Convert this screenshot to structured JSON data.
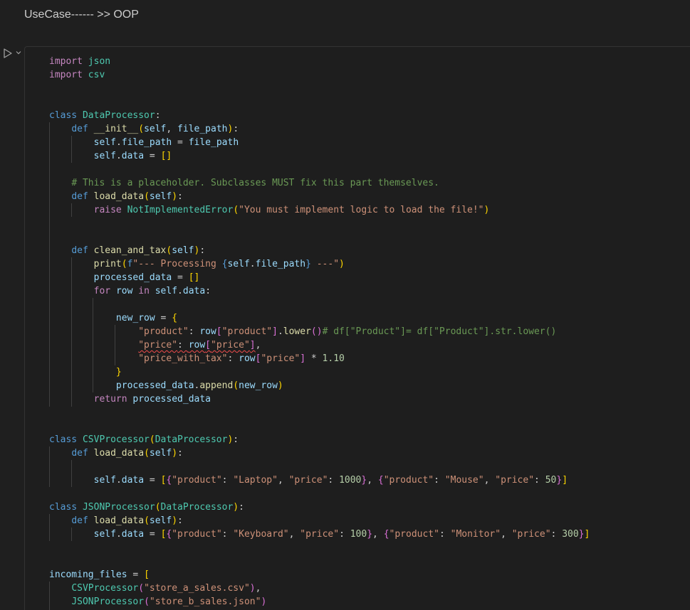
{
  "markdown_heading": "UseCase------ >> OOP",
  "code_lines": [
    [
      [
        "kw",
        "import"
      ],
      [
        "txt",
        " "
      ],
      [
        "cls",
        "json"
      ]
    ],
    [
      [
        "kw",
        "import"
      ],
      [
        "txt",
        " "
      ],
      [
        "cls",
        "csv"
      ]
    ],
    [],
    [],
    [
      [
        "kb",
        "class"
      ],
      [
        "txt",
        " "
      ],
      [
        "cls",
        "DataProcessor"
      ],
      [
        "txt",
        ":"
      ]
    ],
    [
      [
        "txt",
        "    "
      ],
      [
        "kb",
        "def"
      ],
      [
        "txt",
        " "
      ],
      [
        "fn",
        "__init__"
      ],
      [
        "br1",
        "("
      ],
      [
        "var",
        "self"
      ],
      [
        "txt",
        ", "
      ],
      [
        "var",
        "file_path"
      ],
      [
        "br1",
        ")"
      ],
      [
        "txt",
        ":"
      ]
    ],
    [
      [
        "txt",
        "        "
      ],
      [
        "var",
        "self"
      ],
      [
        "txt",
        "."
      ],
      [
        "var",
        "file_path"
      ],
      [
        "txt",
        " = "
      ],
      [
        "var",
        "file_path"
      ]
    ],
    [
      [
        "txt",
        "        "
      ],
      [
        "var",
        "self"
      ],
      [
        "txt",
        "."
      ],
      [
        "var",
        "data"
      ],
      [
        "txt",
        " = "
      ],
      [
        "br1",
        "[]"
      ]
    ],
    [],
    [
      [
        "txt",
        "    "
      ],
      [
        "cmt",
        "# This is a placeholder. Subclasses MUST fix this part themselves."
      ]
    ],
    [
      [
        "txt",
        "    "
      ],
      [
        "kb",
        "def"
      ],
      [
        "txt",
        " "
      ],
      [
        "fn",
        "load_data"
      ],
      [
        "br1",
        "("
      ],
      [
        "var",
        "self"
      ],
      [
        "br1",
        ")"
      ],
      [
        "txt",
        ":"
      ]
    ],
    [
      [
        "txt",
        "        "
      ],
      [
        "kw",
        "raise"
      ],
      [
        "txt",
        " "
      ],
      [
        "cls",
        "NotImplementedError"
      ],
      [
        "br1",
        "("
      ],
      [
        "str",
        "\"You must implement logic to load the file!\""
      ],
      [
        "br1",
        ")"
      ]
    ],
    [],
    [],
    [
      [
        "txt",
        "    "
      ],
      [
        "kb",
        "def"
      ],
      [
        "txt",
        " "
      ],
      [
        "fn",
        "clean_and_tax"
      ],
      [
        "br1",
        "("
      ],
      [
        "var",
        "self"
      ],
      [
        "br1",
        ")"
      ],
      [
        "txt",
        ":"
      ]
    ],
    [
      [
        "txt",
        "        "
      ],
      [
        "fn",
        "print"
      ],
      [
        "br1",
        "("
      ],
      [
        "kb",
        "f"
      ],
      [
        "str",
        "\"--- Processing "
      ],
      [
        "kb",
        "{"
      ],
      [
        "var",
        "self"
      ],
      [
        "txt",
        "."
      ],
      [
        "var",
        "file_path"
      ],
      [
        "kb",
        "}"
      ],
      [
        "str",
        " ---\""
      ],
      [
        "br1",
        ")"
      ]
    ],
    [
      [
        "txt",
        "        "
      ],
      [
        "var",
        "processed_data"
      ],
      [
        "txt",
        " = "
      ],
      [
        "br1",
        "[]"
      ]
    ],
    [
      [
        "txt",
        "        "
      ],
      [
        "kw",
        "for"
      ],
      [
        "txt",
        " "
      ],
      [
        "var",
        "row"
      ],
      [
        "txt",
        " "
      ],
      [
        "kw",
        "in"
      ],
      [
        "txt",
        " "
      ],
      [
        "var",
        "self"
      ],
      [
        "txt",
        "."
      ],
      [
        "var",
        "data"
      ],
      [
        "txt",
        ":"
      ]
    ],
    [],
    [
      [
        "txt",
        "            "
      ],
      [
        "var",
        "new_row"
      ],
      [
        "txt",
        " = "
      ],
      [
        "br1",
        "{"
      ]
    ],
    [
      [
        "txt",
        "                "
      ],
      [
        "str",
        "\"product\""
      ],
      [
        "txt",
        ": "
      ],
      [
        "var",
        "row"
      ],
      [
        "br2",
        "["
      ],
      [
        "str",
        "\"product\""
      ],
      [
        "br2",
        "]"
      ],
      [
        "txt",
        "."
      ],
      [
        "fn",
        "lower"
      ],
      [
        "br2",
        "()"
      ],
      [
        "cmt",
        "# df[\"Product\"]= df[\"Product\"].str.lower()"
      ]
    ],
    [
      [
        "txt",
        "                "
      ],
      [
        "str",
        "\"price\"",
        "sq"
      ],
      [
        "txt",
        ": ",
        "sq"
      ],
      [
        "var",
        "row",
        "sq"
      ],
      [
        "br2",
        "[",
        "sq"
      ],
      [
        "str",
        "\"price\"",
        "sq"
      ],
      [
        "br2",
        "]",
        "sq"
      ],
      [
        "txt",
        ","
      ]
    ],
    [
      [
        "txt",
        "                "
      ],
      [
        "str",
        "\"price_with_tax\""
      ],
      [
        "txt",
        ": "
      ],
      [
        "var",
        "row"
      ],
      [
        "br2",
        "["
      ],
      [
        "str",
        "\"price\""
      ],
      [
        "br2",
        "]"
      ],
      [
        "txt",
        " * "
      ],
      [
        "num",
        "1.10"
      ]
    ],
    [
      [
        "txt",
        "            "
      ],
      [
        "br1",
        "}"
      ]
    ],
    [
      [
        "txt",
        "            "
      ],
      [
        "var",
        "processed_data"
      ],
      [
        "txt",
        "."
      ],
      [
        "fn",
        "append"
      ],
      [
        "br1",
        "("
      ],
      [
        "var",
        "new_row"
      ],
      [
        "br1",
        ")"
      ]
    ],
    [
      [
        "txt",
        "        "
      ],
      [
        "kw",
        "return"
      ],
      [
        "txt",
        " "
      ],
      [
        "var",
        "processed_data"
      ]
    ],
    [],
    [],
    [
      [
        "kb",
        "class"
      ],
      [
        "txt",
        " "
      ],
      [
        "cls",
        "CSVProcessor"
      ],
      [
        "br1",
        "("
      ],
      [
        "cls",
        "DataProcessor"
      ],
      [
        "br1",
        ")"
      ],
      [
        "txt",
        ":"
      ]
    ],
    [
      [
        "txt",
        "    "
      ],
      [
        "kb",
        "def"
      ],
      [
        "txt",
        " "
      ],
      [
        "fn",
        "load_data"
      ],
      [
        "br1",
        "("
      ],
      [
        "var",
        "self"
      ],
      [
        "br1",
        ")"
      ],
      [
        "txt",
        ":"
      ]
    ],
    [],
    [
      [
        "txt",
        "        "
      ],
      [
        "var",
        "self"
      ],
      [
        "txt",
        "."
      ],
      [
        "var",
        "data"
      ],
      [
        "txt",
        " = "
      ],
      [
        "br1",
        "["
      ],
      [
        "br2",
        "{"
      ],
      [
        "str",
        "\"product\""
      ],
      [
        "txt",
        ": "
      ],
      [
        "str",
        "\"Laptop\""
      ],
      [
        "txt",
        ", "
      ],
      [
        "str",
        "\"price\""
      ],
      [
        "txt",
        ": "
      ],
      [
        "num",
        "1000"
      ],
      [
        "br2",
        "}"
      ],
      [
        "txt",
        ", "
      ],
      [
        "br2",
        "{"
      ],
      [
        "str",
        "\"product\""
      ],
      [
        "txt",
        ": "
      ],
      [
        "str",
        "\"Mouse\""
      ],
      [
        "txt",
        ", "
      ],
      [
        "str",
        "\"price\""
      ],
      [
        "txt",
        ": "
      ],
      [
        "num",
        "50"
      ],
      [
        "br2",
        "}"
      ],
      [
        "br1",
        "]"
      ]
    ],
    [],
    [
      [
        "kb",
        "class"
      ],
      [
        "txt",
        " "
      ],
      [
        "cls",
        "JSONProcessor"
      ],
      [
        "br1",
        "("
      ],
      [
        "cls",
        "DataProcessor"
      ],
      [
        "br1",
        ")"
      ],
      [
        "txt",
        ":"
      ]
    ],
    [
      [
        "txt",
        "    "
      ],
      [
        "kb",
        "def"
      ],
      [
        "txt",
        " "
      ],
      [
        "fn",
        "load_data"
      ],
      [
        "br1",
        "("
      ],
      [
        "var",
        "self"
      ],
      [
        "br1",
        ")"
      ],
      [
        "txt",
        ":"
      ]
    ],
    [
      [
        "txt",
        "        "
      ],
      [
        "var",
        "self"
      ],
      [
        "txt",
        "."
      ],
      [
        "var",
        "data"
      ],
      [
        "txt",
        " = "
      ],
      [
        "br1",
        "["
      ],
      [
        "br2",
        "{"
      ],
      [
        "str",
        "\"product\""
      ],
      [
        "txt",
        ": "
      ],
      [
        "str",
        "\"Keyboard\""
      ],
      [
        "txt",
        ", "
      ],
      [
        "str",
        "\"price\""
      ],
      [
        "txt",
        ": "
      ],
      [
        "num",
        "100"
      ],
      [
        "br2",
        "}"
      ],
      [
        "txt",
        ", "
      ],
      [
        "br2",
        "{"
      ],
      [
        "str",
        "\"product\""
      ],
      [
        "txt",
        ": "
      ],
      [
        "str",
        "\"Monitor\""
      ],
      [
        "txt",
        ", "
      ],
      [
        "str",
        "\"price\""
      ],
      [
        "txt",
        ": "
      ],
      [
        "num",
        "300"
      ],
      [
        "br2",
        "}"
      ],
      [
        "br1",
        "]"
      ]
    ],
    [],
    [],
    [
      [
        "var",
        "incoming_files"
      ],
      [
        "txt",
        " = "
      ],
      [
        "br1",
        "["
      ]
    ],
    [
      [
        "txt",
        "    "
      ],
      [
        "cls",
        "CSVProcessor"
      ],
      [
        "br2",
        "("
      ],
      [
        "str",
        "\"store_a_sales.csv\""
      ],
      [
        "br2",
        ")"
      ],
      [
        "txt",
        ","
      ]
    ],
    [
      [
        "txt",
        "    "
      ],
      [
        "cls",
        "JSONProcessor"
      ],
      [
        "br2",
        "("
      ],
      [
        "str",
        "\"store_b_sales.json\""
      ],
      [
        "br2",
        ")"
      ]
    ]
  ]
}
